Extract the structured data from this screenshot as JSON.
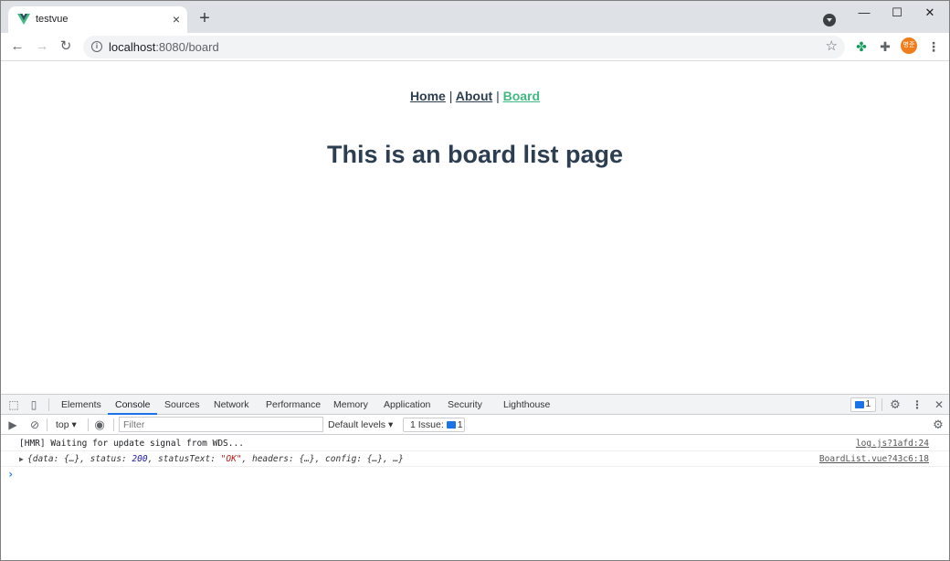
{
  "browser": {
    "tab": {
      "title": "testvue",
      "close_icon": "×"
    },
    "new_tab_icon": "+",
    "window_controls": {
      "minimize": "—",
      "maximize": "☐",
      "close": "✕"
    },
    "toolbar": {
      "back": "←",
      "forward": "→",
      "reload": "↻",
      "url_host": "localhost",
      "url_rest": ":8080/board",
      "bookmark": "☆",
      "avatar_label": "병준"
    }
  },
  "page": {
    "nav": {
      "home": "Home",
      "about": "About",
      "board": "Board",
      "separator": "|",
      "active": "board"
    },
    "heading": "This is an board list page",
    "colors": {
      "text": "#2c3e50",
      "active_link": "#42b983"
    }
  },
  "devtools": {
    "tabs": [
      "Elements",
      "Console",
      "Sources",
      "Network",
      "Performance",
      "Memory",
      "Application",
      "Security",
      "Lighthouse"
    ],
    "active_tab": "Console",
    "message_badge_count": "1",
    "filter_bar": {
      "context": "top",
      "filter_placeholder": "Filter",
      "levels": "Default levels",
      "issues_label": "1 Issue:",
      "issues_count": "1"
    },
    "console": {
      "logs": [
        {
          "text": "[HMR] Waiting for update signal from WDS...",
          "source": "log.js?1afd:24"
        },
        {
          "source": "BoardList.vue?43c6:18",
          "parts": {
            "open": "{data: {…}, status: ",
            "status": "200",
            "mid": ", statusText: ",
            "statusText": "\"OK\"",
            "close": ", headers: {…}, config: {…}, …}"
          }
        }
      ],
      "prompt": "›"
    }
  }
}
